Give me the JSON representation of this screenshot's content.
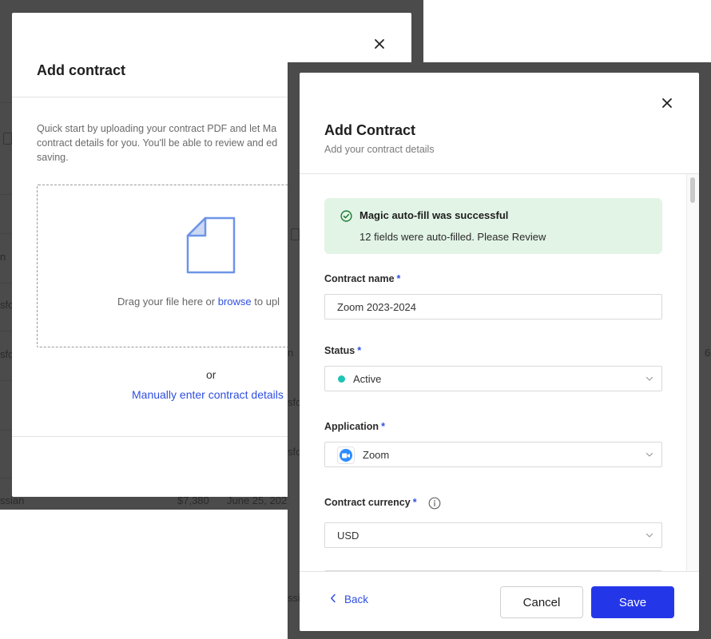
{
  "background_table": {
    "fragments": {
      "r1": "n",
      "r2": "sfo",
      "r3": "sfo",
      "r4": "sfo",
      "r5": "sfo",
      "r6a": "ssian",
      "r6b": "$7,380",
      "r6c": "June 25, 202",
      "r7": "ssi",
      "right_r3a": "n",
      "right_r3b": "6"
    }
  },
  "upload_modal": {
    "title": "Add contract",
    "description": "Quick start by uploading your contract PDF and let Ma contract details for you. You'll be able to review and ed saving.",
    "drop_text_prefix": "Drag your file here or ",
    "drop_link": "browse",
    "drop_text_suffix": " to upl",
    "or": "or",
    "manual_link": "Manually enter contract details"
  },
  "contract_modal": {
    "title": "Add Contract",
    "subtitle": "Add your contract details",
    "alert": {
      "title": "Magic auto-fill was successful",
      "text": "12 fields were auto-filled. Please Review",
      "color": "#e2f4e6"
    },
    "fields": {
      "contract_name": {
        "label": "Contract name",
        "required": "*",
        "value": "Zoom 2023-2024"
      },
      "status": {
        "label": "Status",
        "required": "*",
        "value": "Active",
        "dot_color": "#20c4b4"
      },
      "application": {
        "label": "Application",
        "required": "*",
        "value": "Zoom",
        "icon": "zoom-logo"
      },
      "currency": {
        "label": "Contract currency",
        "required": "*",
        "value": "USD",
        "icon": "info-icon"
      }
    },
    "footer": {
      "back": "Back",
      "cancel": "Cancel",
      "save": "Save",
      "accent": "#2437e8"
    }
  }
}
